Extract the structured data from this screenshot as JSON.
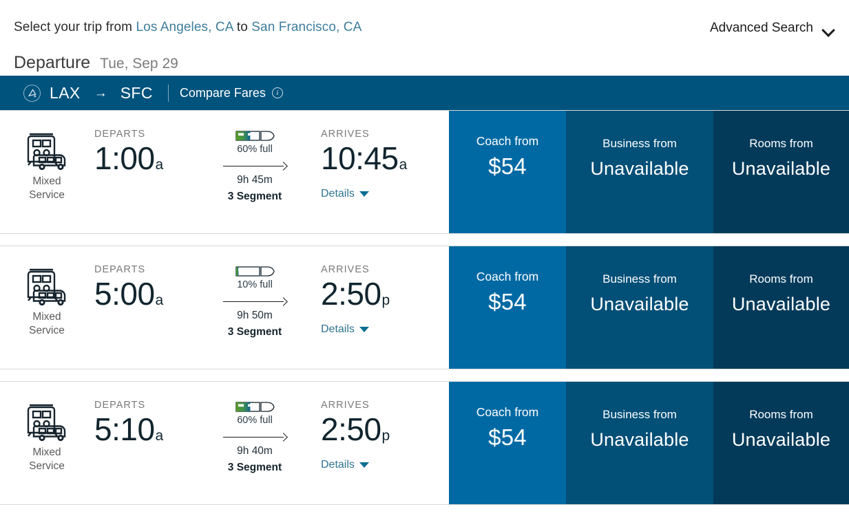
{
  "header": {
    "prefix": "Select your trip from",
    "origin_city": "Los Angeles, CA",
    "middle": "to",
    "destination_city": "San Francisco, CA",
    "advanced_search_label": "Advanced Search",
    "advanced_search_icon": "chevron-down-icon",
    "departure_label": "Departure",
    "departure_date": "Tue, Sep 29"
  },
  "route_bar": {
    "service_icon": "train-circle-icon",
    "origin_code": "LAX",
    "arrow": "→",
    "destination_code": "SFC",
    "compare_fares_label": "Compare Fares",
    "info_icon": "info-icon",
    "background": "#00537d"
  },
  "columns": {
    "departs": "DEPARTS",
    "arrives": "ARRIVES",
    "details": "Details"
  },
  "fare_colors": {
    "coach": "#0069a3",
    "business": "#024f77",
    "rooms": "#033a5a"
  },
  "trips": [
    {
      "service_icon": "train-bus-mixed-icon",
      "service_label_line1": "Mixed",
      "service_label_line2": "Service",
      "depart_time": "1:00",
      "depart_meridiem": "a",
      "occupancy": "60% full",
      "occupancy_percent": 60,
      "duration": "9h 45m",
      "segments": "3 Segment",
      "arrive_time": "10:45",
      "arrive_meridiem": "a",
      "details_label": "Details",
      "fares": [
        {
          "label": "Coach from",
          "value": "$54",
          "tier": "coach"
        },
        {
          "label": "Business from",
          "value": "Unavailable",
          "tier": "business"
        },
        {
          "label": "Rooms from",
          "value": "Unavailable",
          "tier": "rooms"
        }
      ]
    },
    {
      "service_icon": "train-bus-mixed-icon",
      "service_label_line1": "Mixed",
      "service_label_line2": "Service",
      "depart_time": "5:00",
      "depart_meridiem": "a",
      "occupancy": "10% full",
      "occupancy_percent": 10,
      "duration": "9h 50m",
      "segments": "3 Segment",
      "arrive_time": "2:50",
      "arrive_meridiem": "p",
      "details_label": "Details",
      "fares": [
        {
          "label": "Coach from",
          "value": "$54",
          "tier": "coach"
        },
        {
          "label": "Business from",
          "value": "Unavailable",
          "tier": "business"
        },
        {
          "label": "Rooms from",
          "value": "Unavailable",
          "tier": "rooms"
        }
      ]
    },
    {
      "service_icon": "train-bus-mixed-icon",
      "service_label_line1": "Mixed",
      "service_label_line2": "Service",
      "depart_time": "5:10",
      "depart_meridiem": "a",
      "occupancy": "60% full",
      "occupancy_percent": 60,
      "duration": "9h 40m",
      "segments": "3 Segment",
      "arrive_time": "2:50",
      "arrive_meridiem": "p",
      "details_label": "Details",
      "fares": [
        {
          "label": "Coach from",
          "value": "$54",
          "tier": "coach"
        },
        {
          "label": "Business from",
          "value": "Unavailable",
          "tier": "business"
        },
        {
          "label": "Rooms from",
          "value": "Unavailable",
          "tier": "rooms"
        }
      ]
    }
  ]
}
